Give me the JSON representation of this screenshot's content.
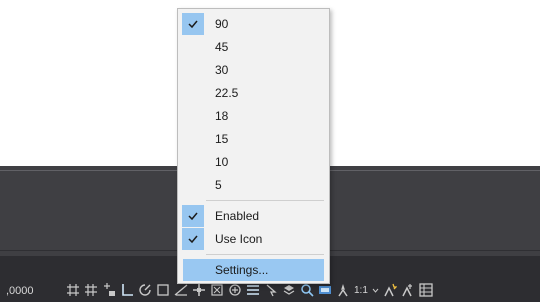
{
  "menu": {
    "angles": [
      {
        "label": "90",
        "checked": true
      },
      {
        "label": "45",
        "checked": false
      },
      {
        "label": "30",
        "checked": false
      },
      {
        "label": "22.5",
        "checked": false
      },
      {
        "label": "18",
        "checked": false
      },
      {
        "label": "15",
        "checked": false
      },
      {
        "label": "10",
        "checked": false
      },
      {
        "label": "5",
        "checked": false
      }
    ],
    "enabled": {
      "label": "Enabled",
      "checked": true
    },
    "use_icon": {
      "label": "Use Icon",
      "checked": true
    },
    "settings": {
      "label": "Settings...",
      "highlighted": true
    }
  },
  "statusbar": {
    "coordinates": ",0000",
    "annotation_scale": "1:1",
    "icons": [
      "grid-icon",
      "snap-grid-icon",
      "infer-constraints-icon",
      "ortho-icon",
      "polar-tracking-icon",
      "isometric-icon",
      "object-snap-tracking-icon",
      "object-snap-icon",
      "lineweight-icon",
      "transparency-icon",
      "selection-cycling-icon",
      "3d-object-snap-icon",
      "dynamic-ucs-icon",
      "selection-filter-icon",
      "gizmo-icon",
      "annotation-visibility-icon",
      "autoscale-icon",
      "workspace-icon"
    ]
  },
  "colors": {
    "check_highlight": "#97c6f0",
    "menu_background": "#f2f2f2",
    "statusbar_background": "#2d2d31"
  }
}
